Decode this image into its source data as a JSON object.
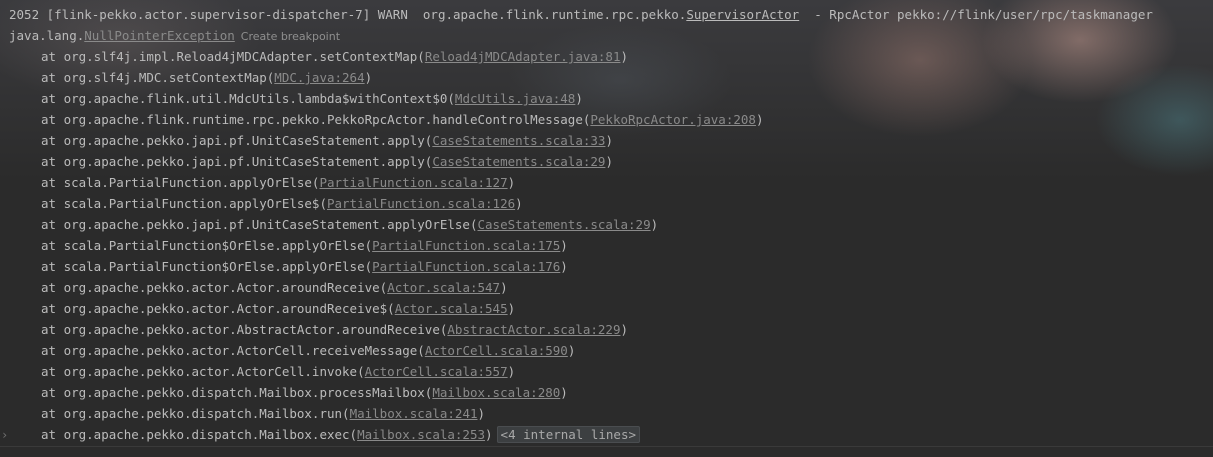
{
  "header": {
    "warn_line": "2052 [flink-pekko.actor.supervisor-dispatcher-7] WARN  org.apache.flink.runtime.rpc.pekko.",
    "warn_class": "SupervisorActor",
    "warn_tail": "  - RpcActor pekko://flink/user/rpc/taskmanager"
  },
  "exception": {
    "prefix": "java.lang.",
    "name": "NullPointerException",
    "create_breakpoint": "Create breakpoint"
  },
  "frames": [
    {
      "text": "at org.slf4j.impl.Reload4jMDCAdapter.setContextMap(",
      "link": "Reload4jMDCAdapter.java:81"
    },
    {
      "text": "at org.slf4j.MDC.setContextMap(",
      "link": "MDC.java:264"
    },
    {
      "text": "at org.apache.flink.util.MdcUtils.lambda$withContext$0(",
      "link": "MdcUtils.java:48"
    },
    {
      "text": "at org.apache.flink.runtime.rpc.pekko.PekkoRpcActor.handleControlMessage(",
      "link": "PekkoRpcActor.java:208"
    },
    {
      "text": "at org.apache.pekko.japi.pf.UnitCaseStatement.apply(",
      "link": "CaseStatements.scala:33"
    },
    {
      "text": "at org.apache.pekko.japi.pf.UnitCaseStatement.apply(",
      "link": "CaseStatements.scala:29"
    },
    {
      "text": "at scala.PartialFunction.applyOrElse(",
      "link": "PartialFunction.scala:127"
    },
    {
      "text": "at scala.PartialFunction.applyOrElse$(",
      "link": "PartialFunction.scala:126"
    },
    {
      "text": "at org.apache.pekko.japi.pf.UnitCaseStatement.applyOrElse(",
      "link": "CaseStatements.scala:29"
    },
    {
      "text": "at scala.PartialFunction$OrElse.applyOrElse(",
      "link": "PartialFunction.scala:175"
    },
    {
      "text": "at scala.PartialFunction$OrElse.applyOrElse(",
      "link": "PartialFunction.scala:176"
    },
    {
      "text": "at org.apache.pekko.actor.Actor.aroundReceive(",
      "link": "Actor.scala:547"
    },
    {
      "text": "at org.apache.pekko.actor.Actor.aroundReceive$(",
      "link": "Actor.scala:545"
    },
    {
      "text": "at org.apache.pekko.actor.AbstractActor.aroundReceive(",
      "link": "AbstractActor.scala:229"
    },
    {
      "text": "at org.apache.pekko.actor.ActorCell.receiveMessage(",
      "link": "ActorCell.scala:590"
    },
    {
      "text": "at org.apache.pekko.actor.ActorCell.invoke(",
      "link": "ActorCell.scala:557"
    },
    {
      "text": "at org.apache.pekko.dispatch.Mailbox.processMailbox(",
      "link": "Mailbox.scala:280"
    },
    {
      "text": "at org.apache.pekko.dispatch.Mailbox.run(",
      "link": "Mailbox.scala:241"
    },
    {
      "text": "at org.apache.pekko.dispatch.Mailbox.exec(",
      "link": "Mailbox.scala:253"
    }
  ],
  "closing_paren": ")",
  "folded_lines": "<4 internal lines>",
  "fold_icon": "chevron-right-icon",
  "colors": {
    "background": "#2b2b2b",
    "text": "#bbbbbb",
    "link": "#8a8a8a"
  }
}
